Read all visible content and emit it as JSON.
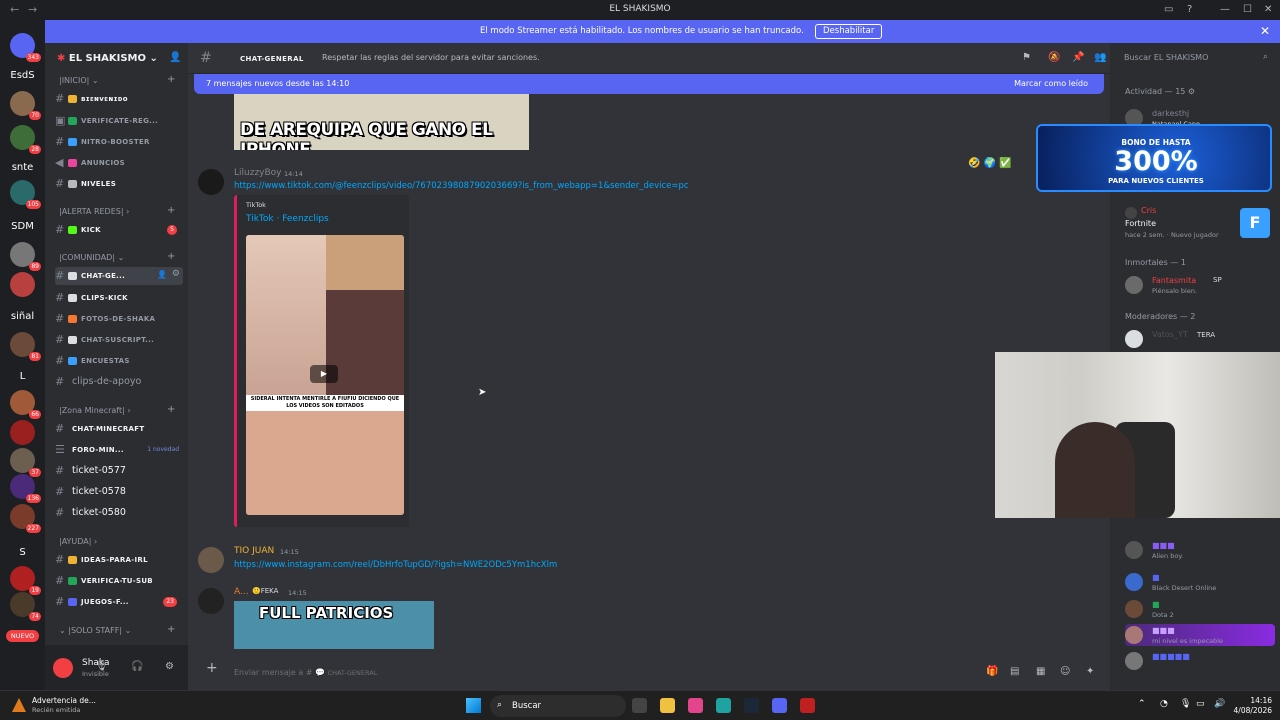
{
  "window": {
    "title": "EL SHAKISMO"
  },
  "banner": {
    "message": "El modo Streamer está habilitado. Los nombres de usuario se han truncado.",
    "button": "Deshabilitar"
  },
  "rail": {
    "items": [
      {
        "label": "343",
        "color": "#5865f2",
        "badge": "343"
      },
      {
        "label": "EsdS",
        "color": "",
        "badge": ""
      },
      {
        "label": "",
        "color": "#8a6a4f",
        "badge": "70"
      },
      {
        "label": "",
        "color": "#3f6d3a",
        "badge": "28"
      },
      {
        "label": "snte",
        "color": "",
        "badge": ""
      },
      {
        "label": "",
        "color": "#2a6a6a",
        "badge": "105"
      },
      {
        "label": "SDM",
        "color": "",
        "badge": ""
      },
      {
        "label": "",
        "color": "#777",
        "badge": "89"
      },
      {
        "label": "",
        "color": "#b8413f",
        "badge": ""
      },
      {
        "label": "siñal",
        "color": "",
        "badge": ""
      },
      {
        "label": "",
        "color": "#6b4a3a",
        "badge": "81"
      },
      {
        "label": "L",
        "color": "",
        "badge": ""
      },
      {
        "label": "",
        "color": "#a05a3a",
        "badge": "66"
      },
      {
        "label": "",
        "color": "#9a1f1f",
        "badge": ""
      },
      {
        "label": "",
        "color": "#6d5f50",
        "badge": "37"
      },
      {
        "label": "",
        "color": "#4b2a7a",
        "badge": "136"
      },
      {
        "label": "",
        "color": "#7a3b2a",
        "badge": "227"
      },
      {
        "label": "S",
        "color": "",
        "badge": ""
      },
      {
        "label": "",
        "color": "#b02020",
        "badge": "19"
      },
      {
        "label": "",
        "color": "#4a3a2a",
        "badge": "74"
      }
    ],
    "nuevo": "NUEVO"
  },
  "sidebar": {
    "server_name": "EL SHAKISMO",
    "categories": [
      {
        "name": "|INICIO|",
        "channels": [
          "ʙɪᴇɴᴠᴇɴɪᴅᴏ",
          "VERIFICATE-REG...",
          "NITRO-BOOSTER",
          "ANUNCIOS",
          "NIVELES"
        ]
      },
      {
        "name": "|ALERTA REDES|",
        "channels": [
          "KICK"
        ]
      },
      {
        "name": "|COMUNIDAD|",
        "channels": [
          "CHAT-GE...",
          "CLIPS-KICK",
          "FOTOS-DE-SHAKA",
          "CHAT-SUSCRIPT...",
          "ENCUESTAS",
          "clips-de-apoyo"
        ]
      },
      {
        "name": "|Zona Minecraft|",
        "channels": [
          "CHAT-MINECRAFT",
          "FORO-MIN...",
          "ticket-0577",
          "ticket-0578",
          "ticket-0580"
        ]
      },
      {
        "name": "|AYUDA|",
        "channels": [
          "IDEAS-PARA-IRL",
          "VERIFICA-TU-SUB",
          "JUEGOS-F..."
        ]
      },
      {
        "name": "|SOLO STAFF|",
        "channels": []
      }
    ],
    "kick_mentions": "5",
    "juegos_mentions": "23",
    "foro_novedad": "1 novedad",
    "user": {
      "name": "Shaka",
      "status": "Invisible"
    }
  },
  "chat": {
    "channel_name": "CHAT-GENERAL",
    "topic": "Respetar las reglas del servidor para evitar sanciones.",
    "new_messages": "7 mensajes nuevos desde las 14:10",
    "mark_read": "Marcar como leído",
    "meme1_caption": "DE AREQUIPA QUE GANO EL IPHONE",
    "messages": [
      {
        "author": "LiluzzyBoy",
        "time": "14:14",
        "link": "https://www.tiktok.com/@feenzclips/video/7670239808790203669?is_from_webapp=1&sender_device=pc",
        "embed": {
          "provider": "TikTok",
          "title": "TikTok · Feenzclips",
          "thumb_caption": "SIDERAL INTENTA MENTIRLE A FIUFIU DICIENDO QUE LOS VIDEOS SON EDITADOS"
        }
      },
      {
        "author": "TIO JUAN",
        "time": "14:15",
        "link": "https://www.instagram.com/reel/DbHrfoTupGD/?igsh=NWE2ODc5Ym1hcXlm"
      },
      {
        "author": "A...",
        "time": "14:15",
        "role": "FEKA",
        "image_caption": "FULL PATRICIOS"
      }
    ],
    "composer_placeholder": "Enviar mensaje a #",
    "composer_channel": "CHAT-GENERAL"
  },
  "members": {
    "search": "Buscar EL SHAKISMO",
    "activity_header": "Actividad — 15",
    "activity": [
      {
        "name": "darkesthj",
        "sub": "Natanael Cano"
      },
      {
        "name": "Cris",
        "sub": "Fortnite"
      }
    ],
    "fortnite_meta": "hace 2 sem.",
    "fortnite_meta2": "Nuevo jugador",
    "ad": {
      "line1": "BONO DE HASTA",
      "line2": "300%",
      "line3": "PARA NUEVOS CLIENTES"
    },
    "groups": [
      {
        "title": "Inmortales — 1",
        "members": [
          {
            "name": "Fantasmita",
            "status": "Piénsalo bien.",
            "tag": "SP"
          }
        ]
      },
      {
        "title": "Moderadores — 2",
        "members": [
          {
            "name": "Vatos_YT",
            "status": "",
            "tag": "TERA"
          }
        ]
      }
    ],
    "more": [
      {
        "name": "",
        "status": "Alien boy."
      },
      {
        "name": "",
        "status": "Black Desert Online"
      },
      {
        "name": "",
        "status": "Dota 2"
      },
      {
        "name": "",
        "status": "mi nivel es impecable"
      },
      {
        "name": "",
        "status": ""
      }
    ]
  },
  "taskbar": {
    "notice_title": "Advertencia de...",
    "notice_sub": "Recién emitida",
    "search": "Buscar",
    "time": "14:16",
    "date": "4/08/2026"
  }
}
